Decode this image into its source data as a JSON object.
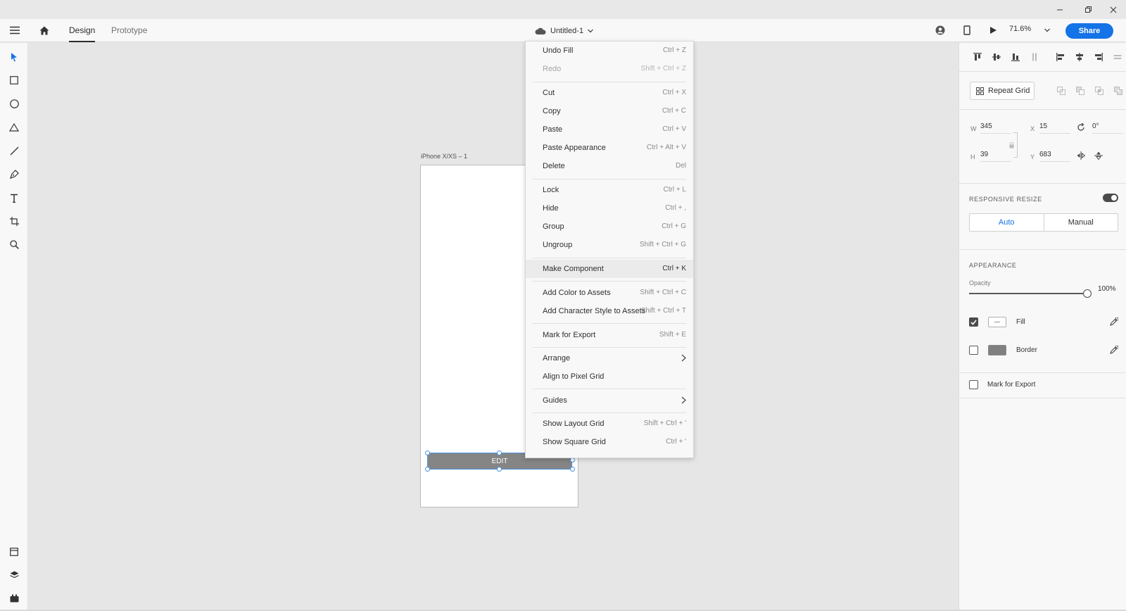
{
  "window": {
    "controls": [
      "minimize-icon",
      "restore-icon",
      "close-icon"
    ]
  },
  "header": {
    "tabs": [
      {
        "label": "Design",
        "active": true
      },
      {
        "label": "Prototype",
        "active": false
      }
    ],
    "document_title": "Untitled-1",
    "zoom": "71.6%",
    "share_label": "Share",
    "accent_color": "#1473e6"
  },
  "tools": [
    "select-icon",
    "rectangle-icon",
    "ellipse-icon",
    "polygon-icon",
    "line-icon",
    "pen-icon",
    "text-icon",
    "artboard-icon",
    "zoom-icon"
  ],
  "bottom_tools": [
    "assets-icon",
    "layers-icon",
    "plugins-icon"
  ],
  "canvas": {
    "artboard_label": "iPhone X/XS – 1",
    "button_text": "EDIT"
  },
  "context_menu": {
    "items": [
      {
        "label": "Undo Fill",
        "shortcut": "Ctrl + Z"
      },
      {
        "label": "Redo",
        "shortcut": "Shift + Ctrl + Z",
        "disabled": true
      },
      {
        "label": "Cut",
        "shortcut": "Ctrl + X"
      },
      {
        "label": "Copy",
        "shortcut": "Ctrl + C"
      },
      {
        "label": "Paste",
        "shortcut": "Ctrl + V"
      },
      {
        "label": "Paste Appearance",
        "shortcut": "Ctrl + Alt + V"
      },
      {
        "label": "Delete",
        "shortcut": "Del"
      },
      {
        "label": "Lock",
        "shortcut": "Ctrl + L"
      },
      {
        "label": "Hide",
        "shortcut": "Ctrl + ,"
      },
      {
        "label": "Group",
        "shortcut": "Ctrl + G"
      },
      {
        "label": "Ungroup",
        "shortcut": "Shift + Ctrl + G"
      },
      {
        "label": "Make Component",
        "shortcut": "Ctrl + K",
        "hover": true
      },
      {
        "label": "Add Color to Assets",
        "shortcut": "Shift + Ctrl + C"
      },
      {
        "label": "Add Character Style to Assets",
        "shortcut": "Shift + Ctrl + T"
      },
      {
        "label": "Mark for Export",
        "shortcut": "Shift + E"
      },
      {
        "label": "Arrange",
        "shortcut": "",
        "submenu": true
      },
      {
        "label": "Align to Pixel Grid",
        "shortcut": ""
      },
      {
        "label": "Guides",
        "shortcut": "",
        "submenu": true
      },
      {
        "label": "Show Layout Grid",
        "shortcut": "Shift + Ctrl + '"
      },
      {
        "label": "Show Square Grid",
        "shortcut": "Ctrl + '"
      }
    ]
  },
  "properties": {
    "repeat_grid_label": "Repeat Grid",
    "w_label": "W",
    "w_value": "345",
    "h_label": "H",
    "h_value": "39",
    "x_label": "X",
    "x_value": "15",
    "y_label": "Y",
    "y_value": "683",
    "rotation_value": "0°",
    "responsive_resize_label": "RESPONSIVE RESIZE",
    "responsive_resize_on": true,
    "auto_label": "Auto",
    "manual_label": "Manual",
    "appearance_label": "APPEARANCE",
    "opacity_label": "Opacity",
    "opacity_value": "100%",
    "opacity_level": 1.0,
    "fill_label": "Fill",
    "fill_checked": true,
    "fill_color": "#ffffff",
    "border_label": "Border",
    "border_checked": false,
    "border_color": "#808080",
    "mark_export_label": "Mark for Export",
    "mark_export_checked": false
  }
}
